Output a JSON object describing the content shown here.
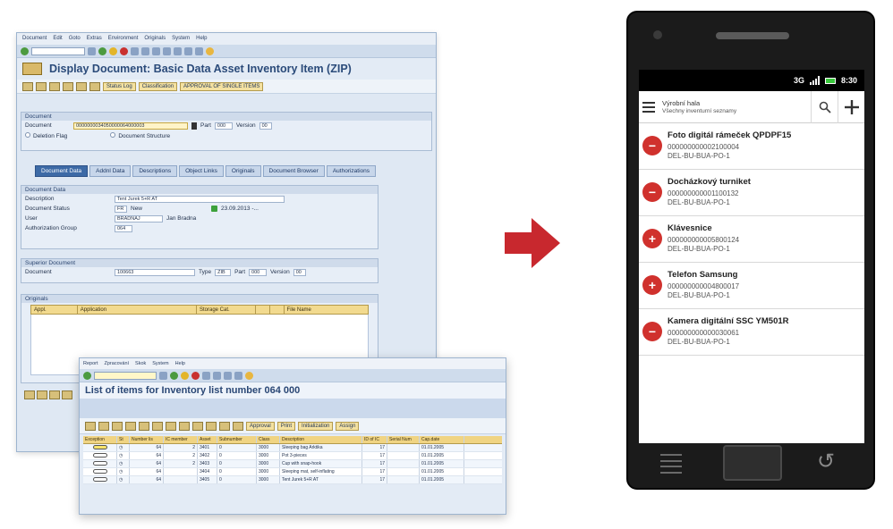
{
  "sap_document": {
    "menu": [
      "Document",
      "Edit",
      "Goto",
      "Extras",
      "Environment",
      "Originals",
      "System",
      "Help"
    ],
    "title": "Display Document: Basic Data Asset Inventory Item (ZIP)",
    "app_buttons": [
      "Status Log",
      "Classification",
      "APPROVAL OF SINGLE ITEMS"
    ],
    "header": {
      "group_title": "Document",
      "document_label": "Document",
      "document_value": "0000000034050000064000003",
      "part_label": "Part",
      "part_value": "000",
      "version_label": "Version",
      "version_value": "00",
      "deletion_flag": "Deletion Flag",
      "document_structure": "Document Structure"
    },
    "tabs": [
      "Document Data",
      "Addnl Data",
      "Descriptions",
      "Object Links",
      "Originals",
      "Document Browser",
      "Authorizations"
    ],
    "document_data": {
      "group_title": "Document Data",
      "description_label": "Description",
      "description_value": "Tent Jurek 5+R AT",
      "status_label": "Document Status",
      "status_code": "FR",
      "status_text": "New",
      "status_date": "23.09.2013 -...",
      "user_label": "User",
      "user_value": "BRADNAJ",
      "user_name": "Jan Bradna",
      "authgroup_label": "Authorization Group",
      "authgroup_value": "064"
    },
    "superior": {
      "group_title": "Superior Document",
      "document_label": "Document",
      "document_value": "100663",
      "type_label": "Type",
      "type_value": "ZIB",
      "part_label": "Part",
      "part_value": "000",
      "version_label": "Version",
      "version_value": "00"
    },
    "originals": {
      "group_title": "Originals",
      "columns": [
        "Appl.",
        "Application",
        "Storage Cat.",
        "",
        "",
        "File Name"
      ]
    }
  },
  "sap_list": {
    "menu": [
      "Report",
      "Zpracování",
      "Skok",
      "System",
      "Help"
    ],
    "title": "List of items for Inventory list number 064 000",
    "toolbar_buttons": [
      "Approval",
      "Print",
      "Initialization",
      "Assign"
    ],
    "columns": [
      "Exception",
      "St",
      "Number lis",
      "IC member",
      "Asset",
      "Subnumber",
      "Class",
      "Description",
      "ID of IC",
      "Serial Num",
      "Cap.date"
    ],
    "rows": [
      {
        "number": "64",
        "ic": "2",
        "asset": "3401",
        "sub": "0",
        "class": "3000",
        "desc": "Sleeping bag Arktika",
        "id": "17",
        "serial": "",
        "date": "01.01.2005"
      },
      {
        "number": "64",
        "ic": "2",
        "asset": "3402",
        "sub": "0",
        "class": "3000",
        "desc": "Pot 3-pieces",
        "id": "17",
        "serial": "",
        "date": "01.01.2005"
      },
      {
        "number": "64",
        "ic": "2",
        "asset": "3403",
        "sub": "0",
        "class": "3000",
        "desc": "Cup with snap-hook",
        "id": "17",
        "serial": "",
        "date": "01.01.2005"
      },
      {
        "number": "64",
        "ic": "",
        "asset": "3404",
        "sub": "0",
        "class": "3000",
        "desc": "Sleeping mat, self-inflating",
        "id": "17",
        "serial": "",
        "date": "01.01.2005"
      },
      {
        "number": "64",
        "ic": "",
        "asset": "3405",
        "sub": "0",
        "class": "3000",
        "desc": "Tent Jurek 5+R AT",
        "id": "17",
        "serial": "",
        "date": "01.01.2005"
      }
    ]
  },
  "phone": {
    "status": {
      "network": "3G",
      "time": "8:30"
    },
    "header": {
      "line1": "Výrobní hala",
      "line2": "Všechny inventurní seznamy"
    },
    "items": [
      {
        "name": "Foto digitál rámeček QPDPF15",
        "number": "000000000002100004",
        "location": "DEL-BU-BUA-PO-1",
        "action": "remove"
      },
      {
        "name": "Docházkový turniket",
        "number": "000000000001100132",
        "location": "DEL-BU-BUA-PO-1",
        "action": "remove"
      },
      {
        "name": "Klávesnice",
        "number": "000000000005800124",
        "location": "DEL-BU-BUA-PO-1",
        "action": "add"
      },
      {
        "name": "Telefon Samsung",
        "number": "000000000004800017",
        "location": "DEL-BU-BUA-PO-1",
        "action": "add"
      },
      {
        "name": "Kamera digitální SSC YM501R",
        "number": "000000000000030061",
        "location": "DEL-BU-BUA-PO-1",
        "action": "remove"
      }
    ]
  },
  "colors": {
    "accent_red": "#d0312d",
    "arrow_red": "#c8282e",
    "sap_title_blue": "#2b4b7a"
  }
}
